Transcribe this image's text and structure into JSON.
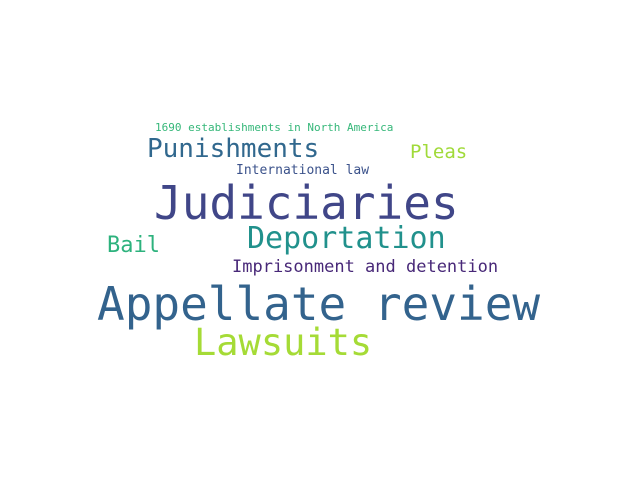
{
  "words": [
    {
      "key": "w1690",
      "text": "1690 establishments in North America",
      "color": "#35b779"
    },
    {
      "key": "punishments",
      "text": "Punishments",
      "color": "#31688e"
    },
    {
      "key": "pleas",
      "text": "Pleas",
      "color": "#a0da39"
    },
    {
      "key": "international_law",
      "text": "International law",
      "color": "#3b528b"
    },
    {
      "key": "judiciaries",
      "text": "Judiciaries",
      "color": "#404688"
    },
    {
      "key": "deportation",
      "text": "Deportation",
      "color": "#21918c"
    },
    {
      "key": "bail",
      "text": "Bail",
      "color": "#2db27d"
    },
    {
      "key": "imprisonment",
      "text": "Imprisonment and detention",
      "color": "#482878"
    },
    {
      "key": "appellate_review",
      "text": "Appellate review",
      "color": "#33638d"
    },
    {
      "key": "lawsuits",
      "text": "Lawsuits",
      "color": "#a5db36"
    }
  ]
}
